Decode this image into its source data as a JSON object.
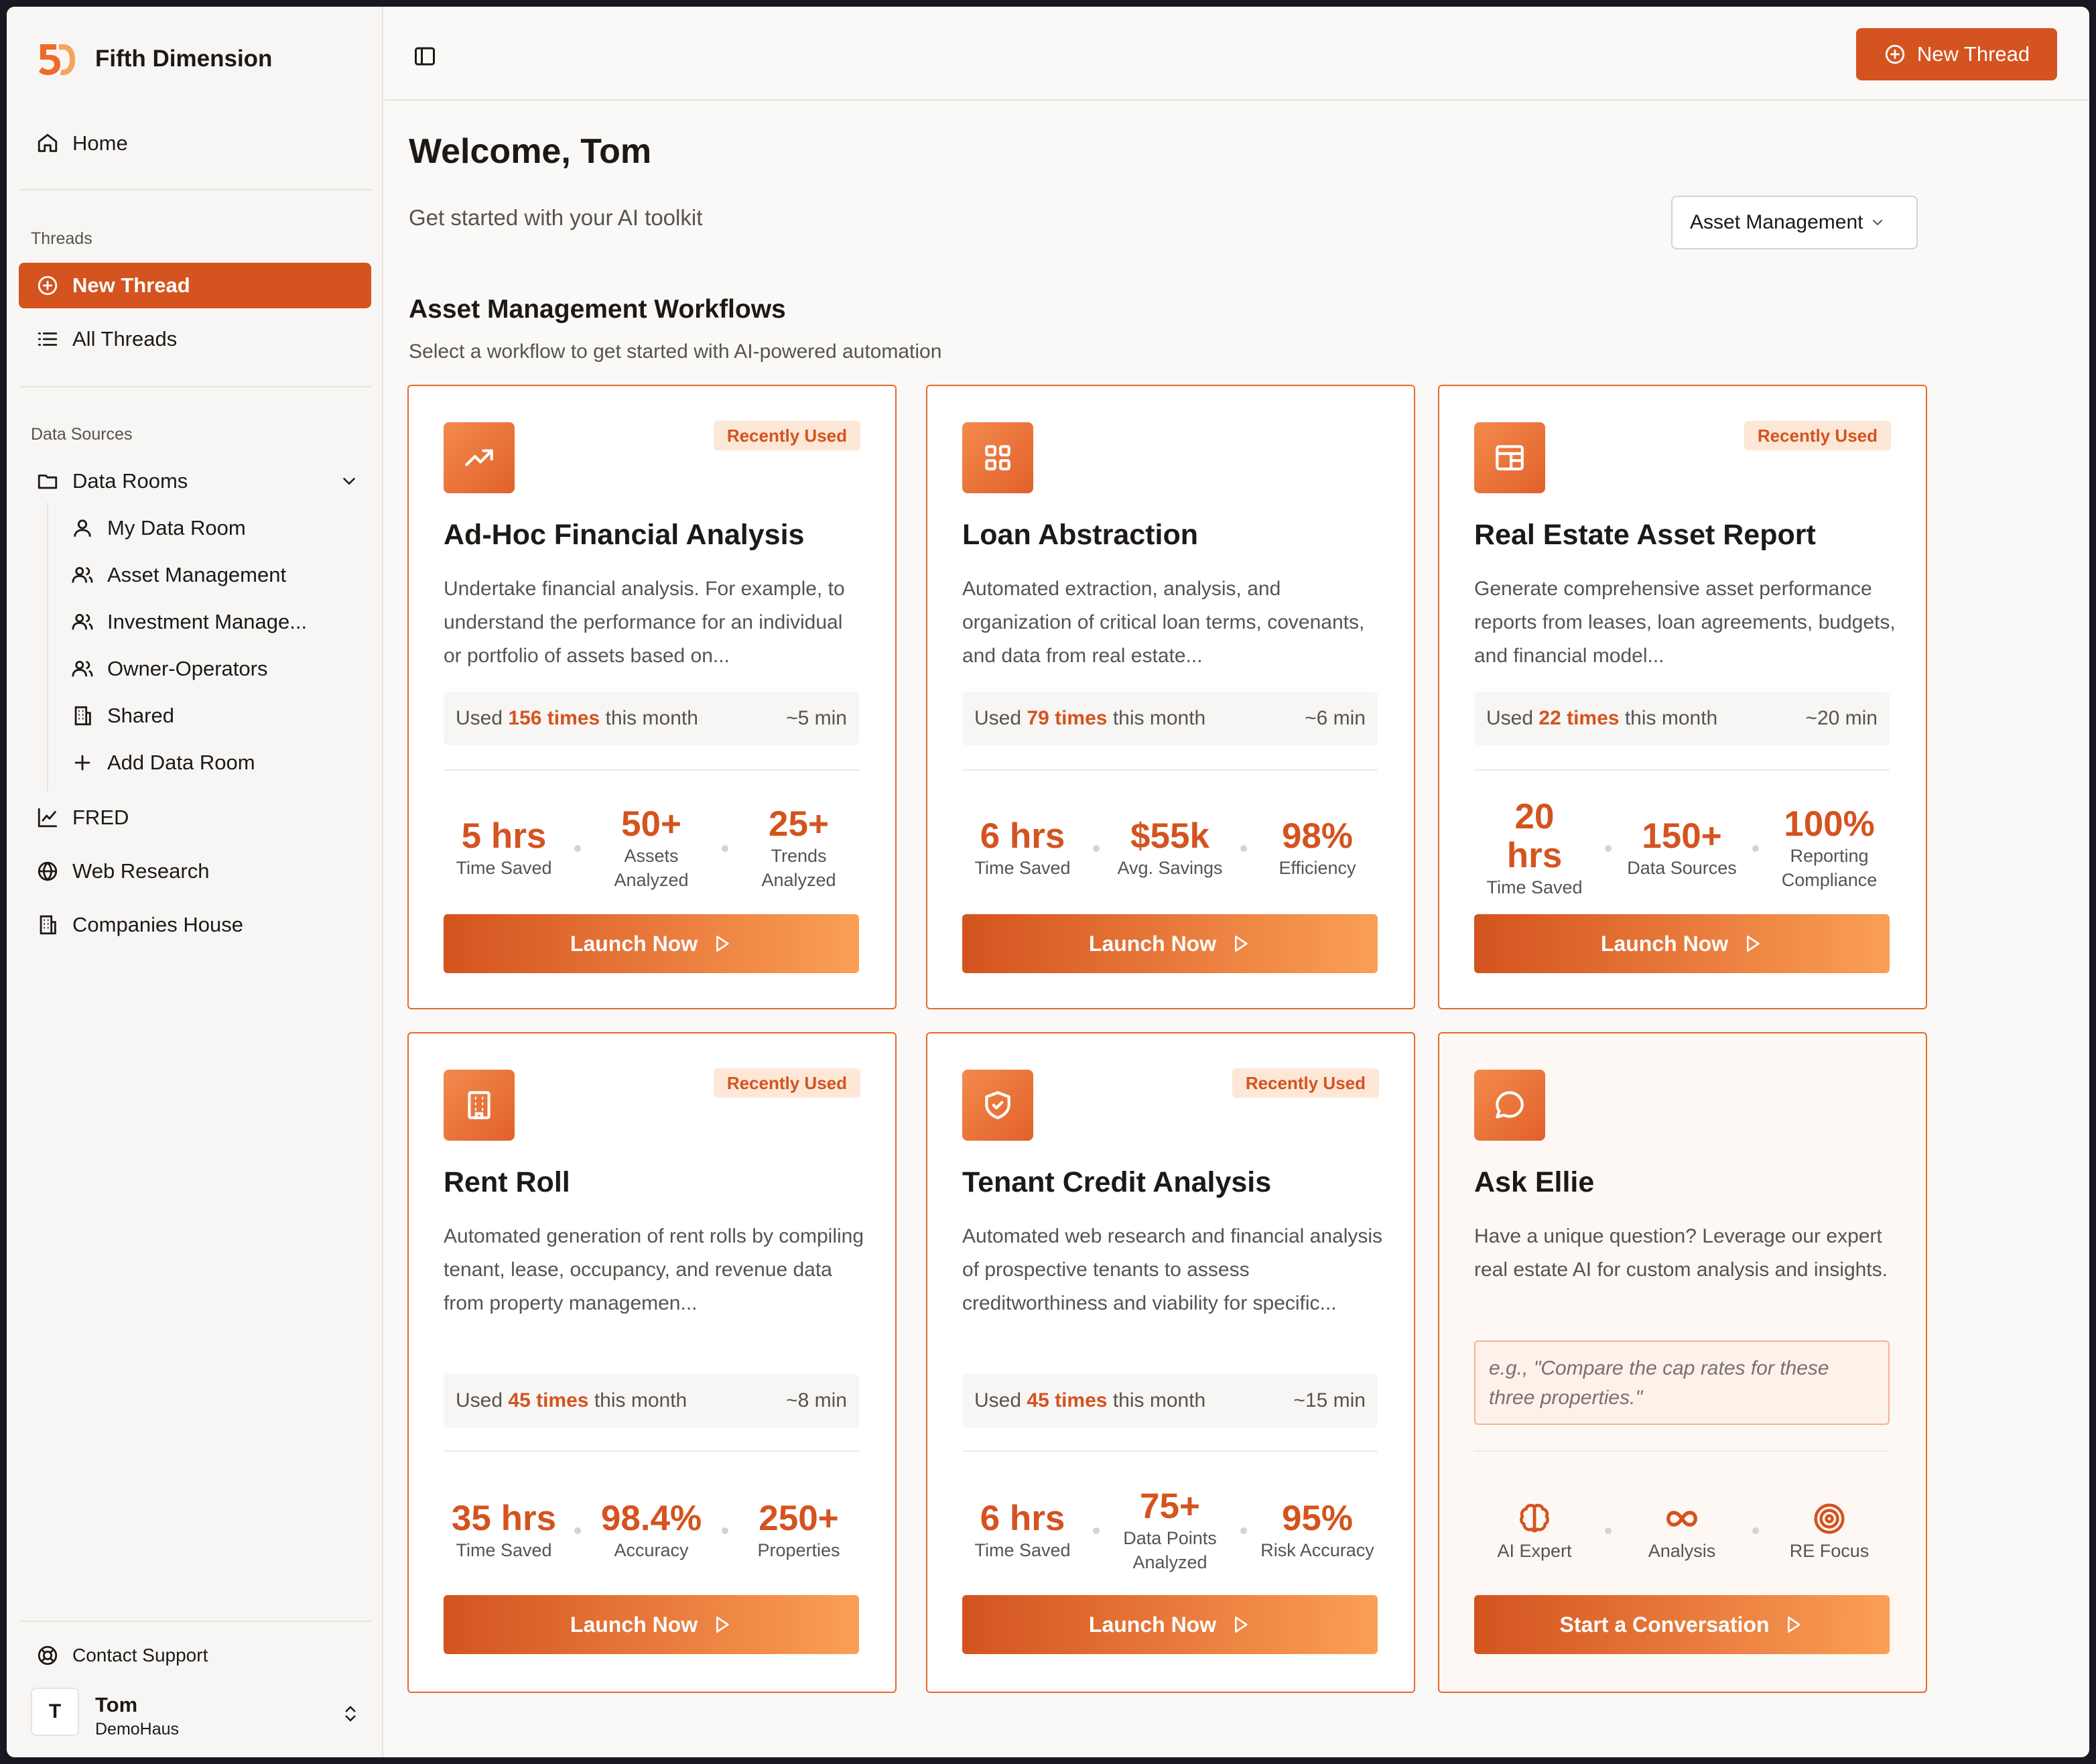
{
  "app": {
    "name": "Fifth Dimension"
  },
  "sidebar": {
    "home": "Home",
    "threads_label": "Threads",
    "new_thread": "New Thread",
    "all_threads": "All Threads",
    "data_sources_label": "Data Sources",
    "data_rooms": "Data Rooms",
    "rooms": [
      "My Data Room",
      "Asset Management",
      "Investment Manage...",
      "Owner-Operators",
      "Shared",
      "Add Data Room"
    ],
    "fred": "FRED",
    "web_research": "Web Research",
    "companies_house": "Companies House",
    "contact_support": "Contact Support",
    "user": {
      "initial": "T",
      "name": "Tom",
      "org": "DemoHaus"
    }
  },
  "header": {
    "new_thread": "New Thread"
  },
  "main": {
    "welcome": "Welcome, Tom",
    "tagline": "Get started with your AI toolkit",
    "selector": "Asset Management",
    "section_title": "Asset Management Workflows",
    "section_subtitle": "Select a workflow to get started with AI-powered automation"
  },
  "cards": [
    {
      "title": "Ad-Hoc Financial Analysis",
      "badge": "Recently Used",
      "desc": "Undertake financial analysis. For example, to understand the performance for an individual or portfolio of assets based on...",
      "used_prefix": "Used",
      "count": "156 times",
      "used_suffix": "this month",
      "time": "~5 min",
      "stats": [
        {
          "v": "5 hrs",
          "l": "Time Saved"
        },
        {
          "v": "50+",
          "l": "Assets Analyzed"
        },
        {
          "v": "25+",
          "l": "Trends Analyzed"
        }
      ],
      "cta": "Launch Now"
    },
    {
      "title": "Loan Abstraction",
      "badge": "",
      "desc": "Automated extraction, analysis, and organization of critical loan terms, covenants, and data from real estate...",
      "used_prefix": "Used",
      "count": "79 times",
      "used_suffix": "this month",
      "time": "~6 min",
      "stats": [
        {
          "v": "6 hrs",
          "l": "Time Saved"
        },
        {
          "v": "$55k",
          "l": "Avg. Savings"
        },
        {
          "v": "98%",
          "l": "Efficiency"
        }
      ],
      "cta": "Launch Now"
    },
    {
      "title": "Real Estate Asset Report",
      "badge": "Recently Used",
      "desc": "Generate comprehensive asset performance reports from leases, loan agreements, budgets, and financial model...",
      "used_prefix": "Used",
      "count": "22 times",
      "used_suffix": "this month",
      "time": "~20 min",
      "stats": [
        {
          "v": "20 hrs",
          "l": "Time Saved"
        },
        {
          "v": "150+",
          "l": "Data Sources"
        },
        {
          "v": "100%",
          "l": "Reporting Compliance"
        }
      ],
      "cta": "Launch Now"
    },
    {
      "title": "Rent Roll",
      "badge": "Recently Used",
      "desc": "Automated generation of rent rolls by compiling tenant, lease, occupancy, and revenue data from property managemen...",
      "used_prefix": "Used",
      "count": "45 times",
      "used_suffix": "this month",
      "time": "~8 min",
      "stats": [
        {
          "v": "35 hrs",
          "l": "Time Saved"
        },
        {
          "v": "98.4%",
          "l": "Accuracy"
        },
        {
          "v": "250+",
          "l": "Properties"
        }
      ],
      "cta": "Launch Now"
    },
    {
      "title": "Tenant Credit Analysis",
      "badge": "Recently Used",
      "desc": "Automated web research and financial analysis of prospective tenants to assess creditworthiness and viability for specific...",
      "used_prefix": "Used",
      "count": "45 times",
      "used_suffix": "this month",
      "time": "~15 min",
      "stats": [
        {
          "v": "6 hrs",
          "l": "Time Saved"
        },
        {
          "v": "75+",
          "l": "Data Points Analyzed"
        },
        {
          "v": "95%",
          "l": "Risk Accuracy"
        }
      ],
      "cta": "Launch Now"
    }
  ],
  "ask": {
    "title": "Ask Ellie",
    "desc": "Have a unique question? Leverage our expert real estate AI for custom analysis and insights.",
    "placeholder": "e.g., \"Compare the cap rates for these three properties.\"",
    "features": [
      "AI Expert",
      "Analysis",
      "RE Focus"
    ],
    "cta": "Start a Conversation"
  },
  "colors": {
    "accent": "#d4531f",
    "accent_light": "#fb9f56",
    "badge_bg": "#fde7d7",
    "border": "#e8672f"
  }
}
